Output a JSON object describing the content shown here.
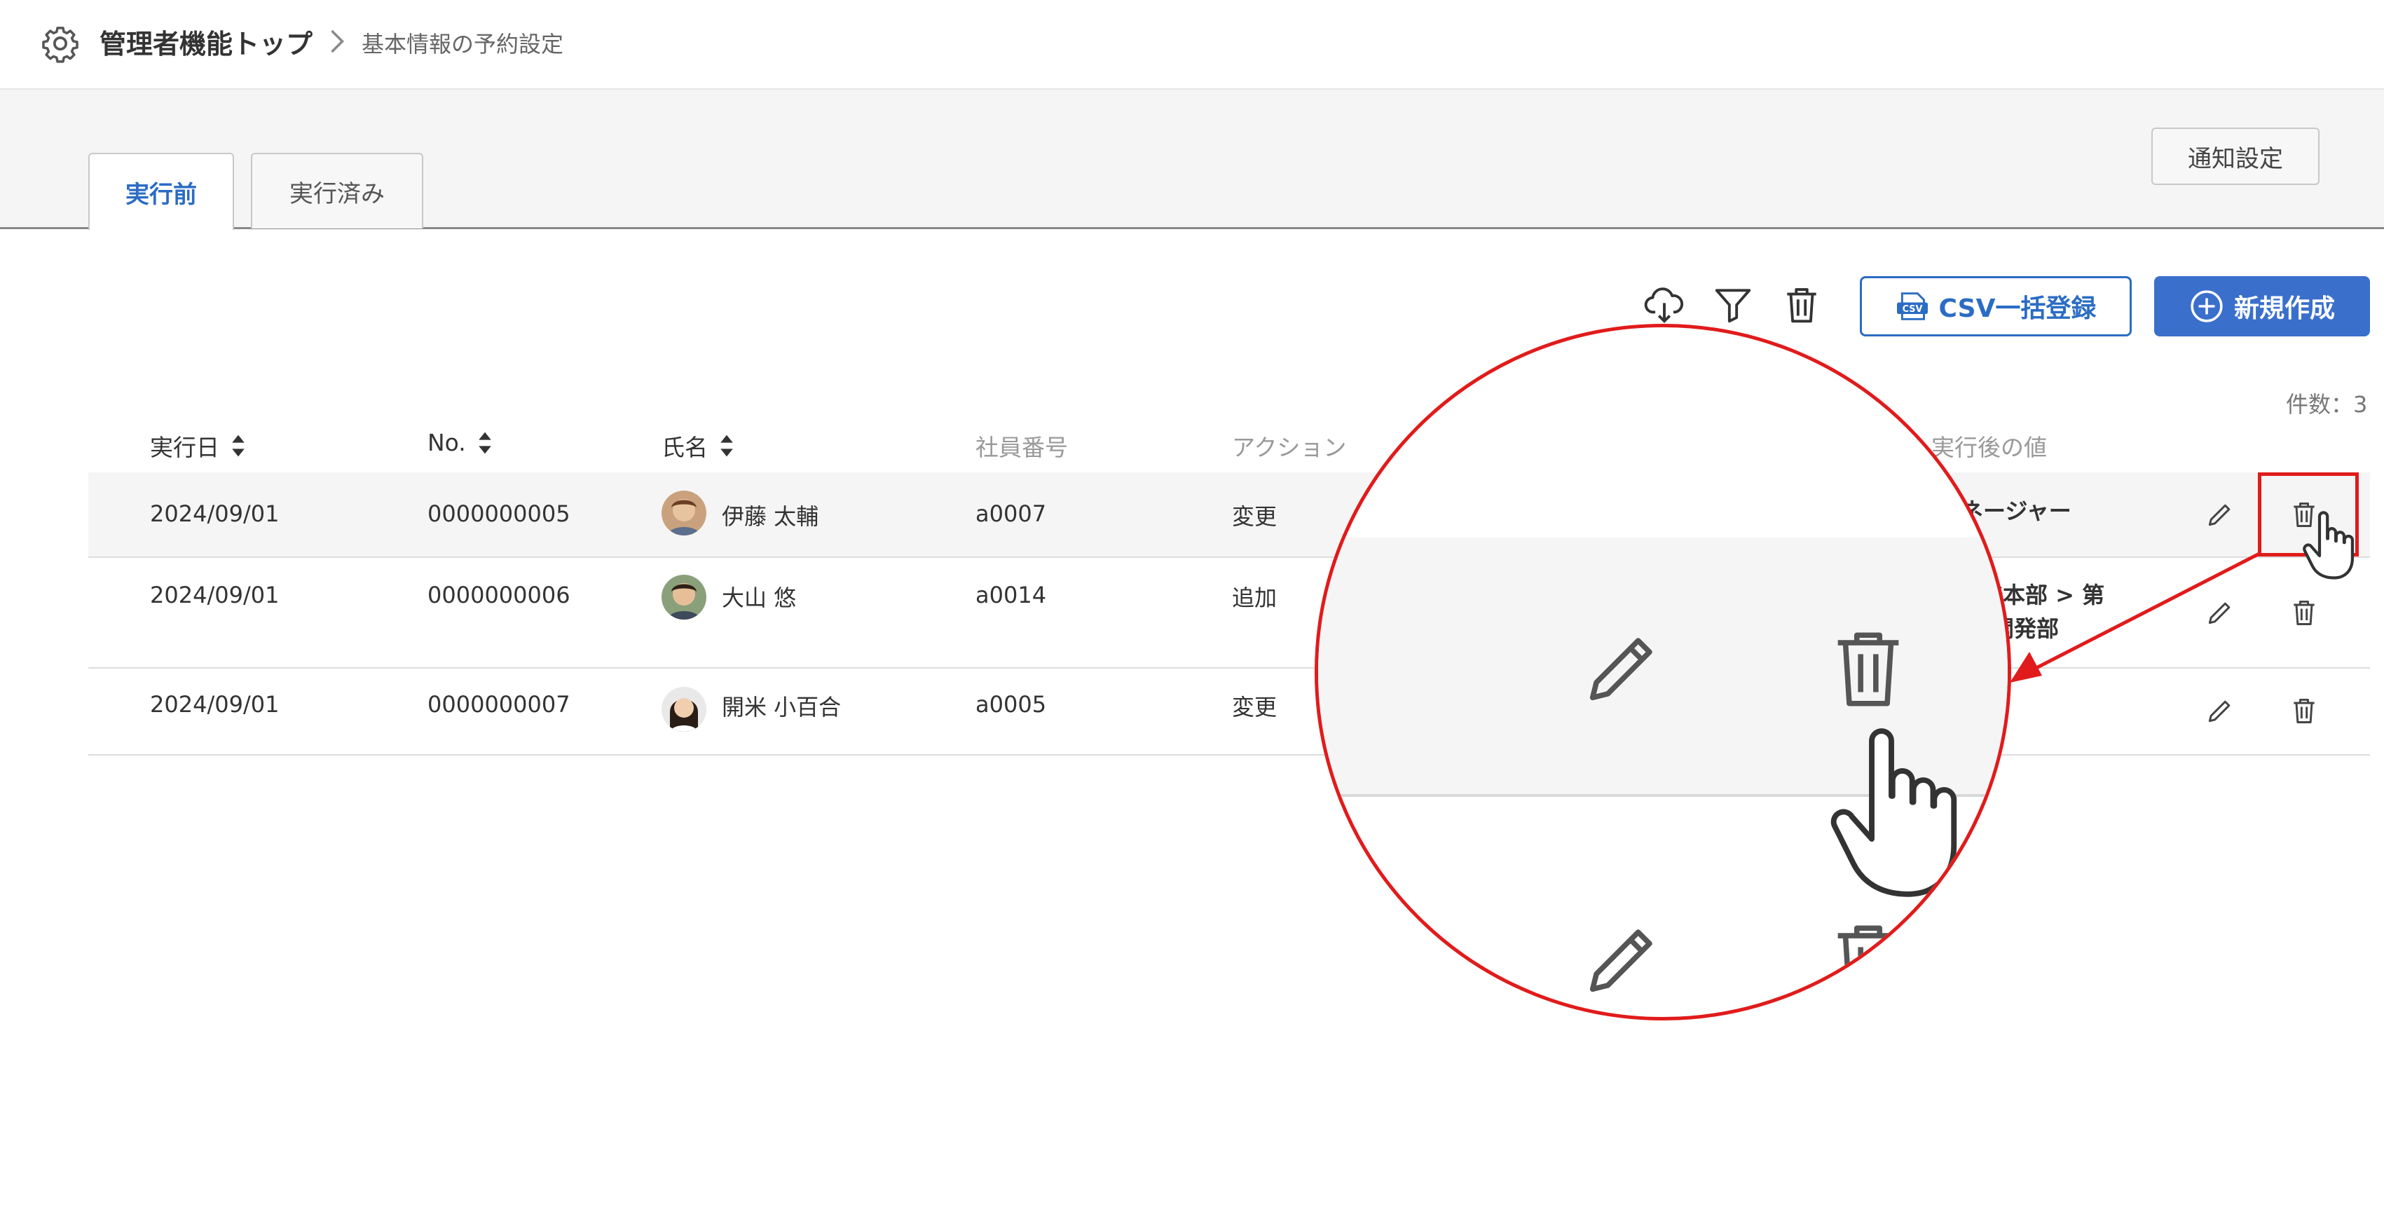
{
  "breadcrumb": {
    "top": "管理者機能トップ",
    "separator": ">",
    "current": "基本情報の予約設定"
  },
  "tabs": [
    {
      "label": "実行前",
      "active": true
    },
    {
      "label": "実行済み",
      "active": false
    }
  ],
  "notify_button": "通知設定",
  "toolbar": {
    "download_icon": "cloud-download-icon",
    "filter_icon": "filter-icon",
    "delete_icon": "trash-icon",
    "csv_badge": "CSV",
    "csv_button": "CSV一括登録",
    "new_button": "新規作成"
  },
  "count_label": "件数：3",
  "columns": {
    "date": "実行日",
    "no": "No.",
    "name": "氏名",
    "employee_no": "社員番号",
    "action": "アクション",
    "after_value": "実行後の値"
  },
  "rows": [
    {
      "date": "2024/09/01",
      "no": "0000000005",
      "name": "伊藤 太輔",
      "employee_no": "a0007",
      "action": "変更",
      "after_value": "ネージャー",
      "after_value_2": ""
    },
    {
      "date": "2024/09/01",
      "no": "0000000006",
      "name": "大山 悠",
      "employee_no": "a0014",
      "action": "追加",
      "after_value": "発本部 > 第",
      "after_value_2": "開発部"
    },
    {
      "date": "2024/09/01",
      "no": "0000000007",
      "name": "開米 小百合",
      "employee_no": "a0005",
      "action": "変更",
      "after_value": "",
      "after_value_2": ""
    }
  ],
  "colors": {
    "accent": "#2b6cc4",
    "primary_button": "#3a6fcc",
    "highlight": "#e11b1b",
    "band": "#f5f5f6"
  }
}
